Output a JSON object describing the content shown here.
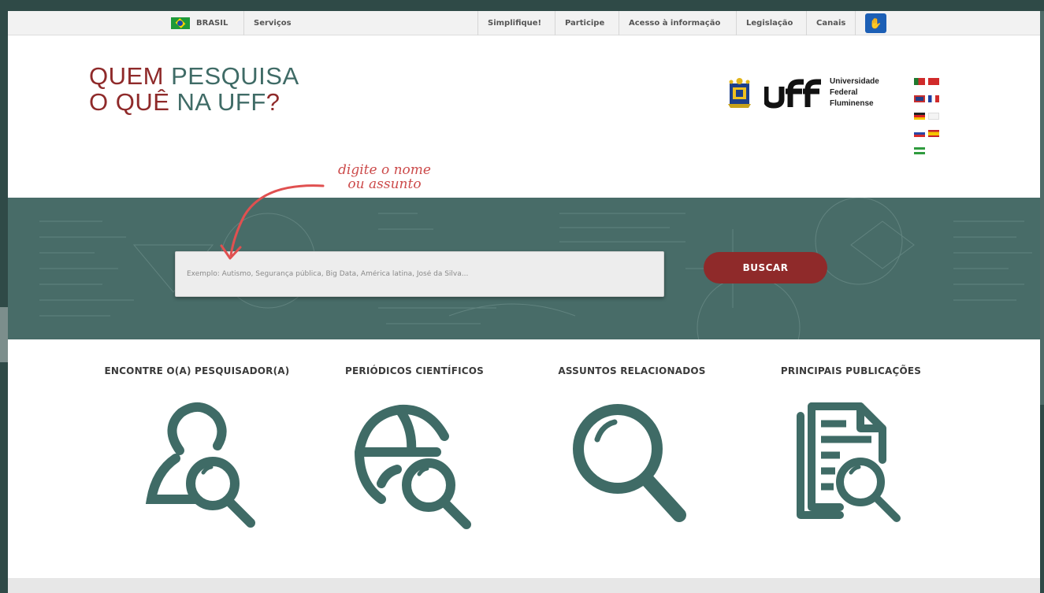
{
  "govbar": {
    "country": "BRASIL",
    "services": "Serviços",
    "links": [
      "Simplifique!",
      "Participe",
      "Acesso à informação",
      "Legislação",
      "Canais"
    ],
    "accessibility_icon": "hand-accessibility-icon"
  },
  "header": {
    "title_line1_a": "QUEM",
    "title_line1_b": "PESQUISA",
    "title_line2_a": "O QUÊ",
    "title_line2_b": "NA UFF",
    "title_qmark": "?",
    "uff_name_1": "Universidade",
    "uff_name_2": "Federal",
    "uff_name_3": "Fluminense"
  },
  "hint": {
    "line1": "digite o nome",
    "line2": "ou assunto"
  },
  "search": {
    "placeholder": "Exemplo: Autismo, Segurança pública, Big Data, América latina, José da Silva...",
    "button": "BUSCAR"
  },
  "features": [
    {
      "label": "ENCONTRE O(A) PESQUISADOR(A)",
      "icon": "person-search-icon"
    },
    {
      "label": "PERIÓDICOS CIENTÍFICOS",
      "icon": "globe-search-icon"
    },
    {
      "label": "ASSUNTOS RELACIONADOS",
      "icon": "magnifier-icon"
    },
    {
      "label": "PRINCIPAIS PUBLICAÇÕES",
      "icon": "document-search-icon"
    }
  ],
  "colors": {
    "brand_red": "#8f2a2a",
    "brand_green": "#3f6b66",
    "hero_bg": "#486c68",
    "hint": "#cc4b4b"
  }
}
